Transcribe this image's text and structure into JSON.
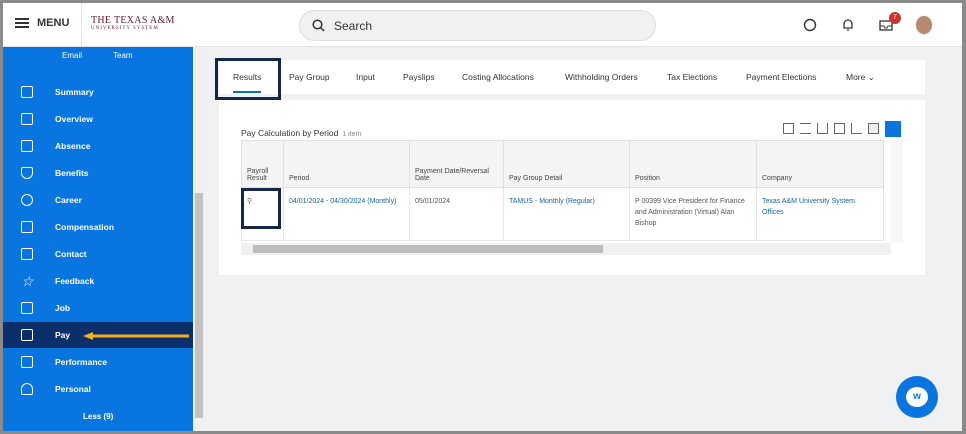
{
  "header": {
    "menu_label": "MENU",
    "logo_line1": "THE TEXAS A&M",
    "logo_line2": "UNIVERSITY SYSTEM",
    "search_placeholder": "Search",
    "inbox_count": "7"
  },
  "sidebar": {
    "top_links": [
      "Email",
      "Team"
    ],
    "items": [
      {
        "label": "Summary"
      },
      {
        "label": "Overview"
      },
      {
        "label": "Absence"
      },
      {
        "label": "Benefits"
      },
      {
        "label": "Career"
      },
      {
        "label": "Compensation"
      },
      {
        "label": "Contact"
      },
      {
        "label": "Feedback"
      },
      {
        "label": "Job"
      },
      {
        "label": "Pay",
        "selected": true
      },
      {
        "label": "Performance"
      },
      {
        "label": "Personal"
      }
    ],
    "less_label": "Less (9)",
    "accent": "#0875e1",
    "selected_color": "#0b2f6a"
  },
  "tabs": [
    {
      "label": "Results",
      "active": true
    },
    {
      "label": "Pay Group"
    },
    {
      "label": "Input"
    },
    {
      "label": "Payslips"
    },
    {
      "label": "Costing Allocations"
    },
    {
      "label": "Withholding Orders"
    },
    {
      "label": "Tax Elections"
    },
    {
      "label": "Payment Elections"
    },
    {
      "label": "More"
    }
  ],
  "grid": {
    "title": "Pay Calculation by Period",
    "count": "1 item",
    "columns": [
      "Payroll Result",
      "Period",
      "Payment Date/Reversal Date",
      "Pay Group Detail",
      "Position",
      "Company"
    ],
    "rows": [
      {
        "period": "04/01/2024 - 04/30/2024 (Monthly)",
        "payment_date": "05/01/2024",
        "pay_group": "TAMUS - Monthly (Regular)",
        "position": "P 00399 Vice President for Finance and Administration (Virtual) Alan Bishop",
        "company": "Texas A&M University System Offices"
      }
    ]
  }
}
